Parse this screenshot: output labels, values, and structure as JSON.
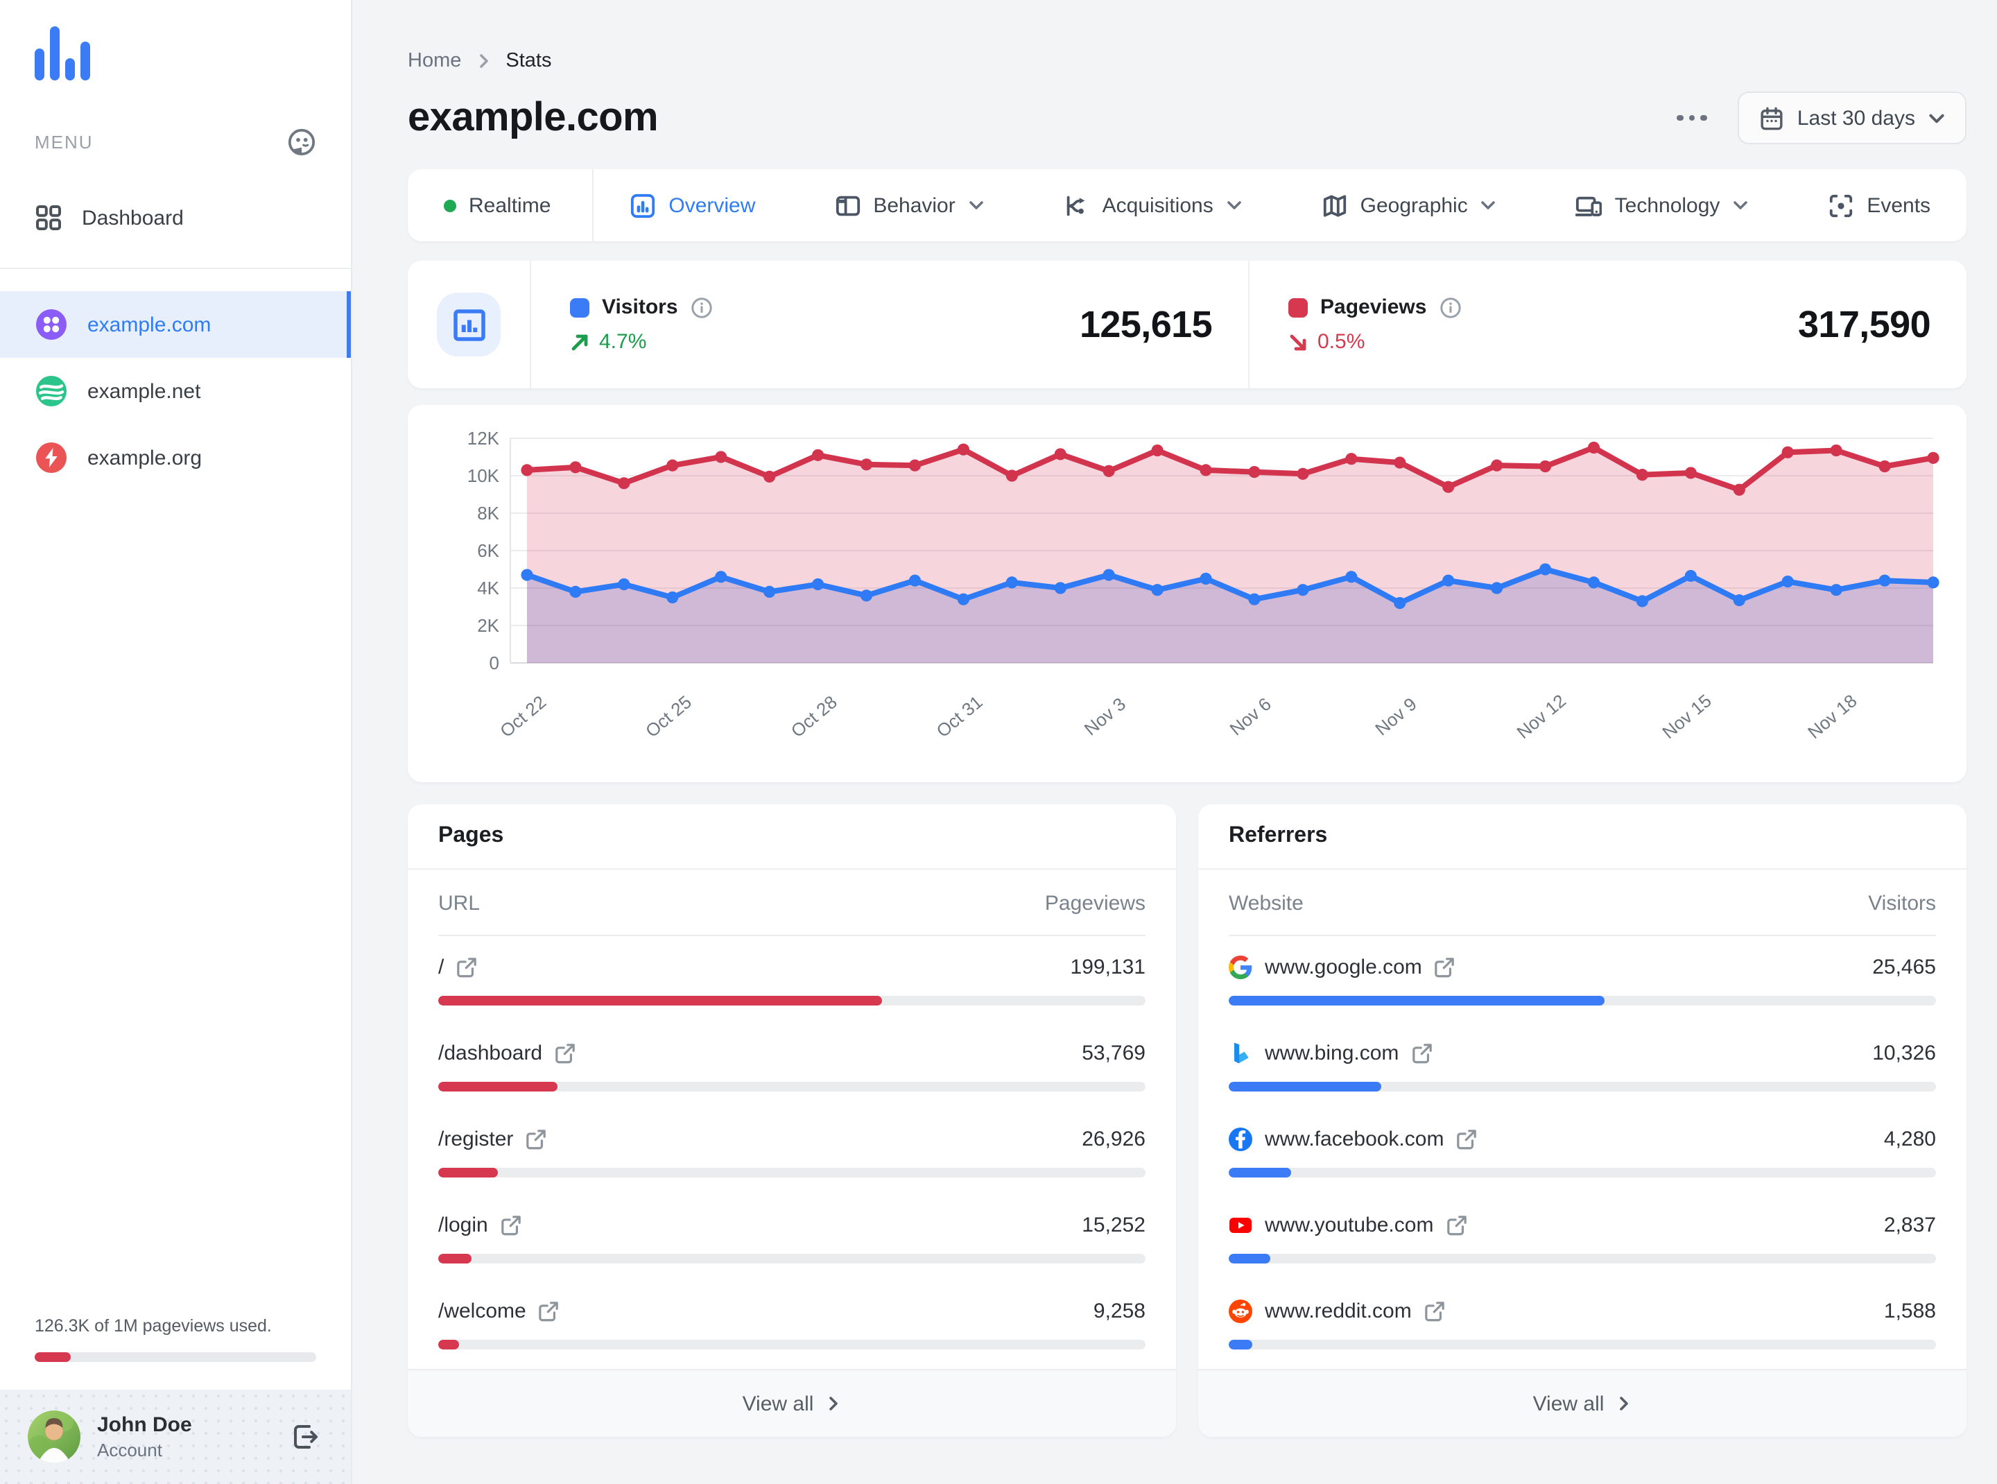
{
  "colors": {
    "accent_blue": "#3b7cf6",
    "accent_red": "#d6394f",
    "positive_green": "#1a9e4b",
    "negative_red": "#d63a4f",
    "realtime_green": "#1ea952",
    "site_purple": "#8b5cf6",
    "site_green": "#2bc48a",
    "site_red": "#ea5455"
  },
  "sidebar": {
    "menu_label": "MENU",
    "dashboard_label": "Dashboard",
    "sites": [
      {
        "label": "example.com"
      },
      {
        "label": "example.net"
      },
      {
        "label": "example.org"
      }
    ],
    "usage_text": "126.3K of 1M pageviews used.",
    "usage_used": 126300,
    "usage_total": 1000000,
    "user": {
      "name": "John Doe",
      "role": "Account"
    }
  },
  "header": {
    "breadcrumb_home": "Home",
    "breadcrumb_current": "Stats",
    "title": "example.com",
    "date_range": "Last 30 days"
  },
  "tabs": [
    {
      "label": "Realtime"
    },
    {
      "label": "Overview"
    },
    {
      "label": "Behavior"
    },
    {
      "label": "Acquisitions"
    },
    {
      "label": "Geographic"
    },
    {
      "label": "Technology"
    },
    {
      "label": "Events"
    }
  ],
  "stats": {
    "visitors": {
      "label": "Visitors",
      "value": "125,615",
      "change": "4.7%",
      "direction": "up"
    },
    "pageviews": {
      "label": "Pageviews",
      "value": "317,590",
      "change": "0.5%",
      "direction": "down"
    }
  },
  "chart_data": {
    "type": "area",
    "title": "",
    "xlabel": "",
    "ylabel": "",
    "ylim": [
      0,
      12000
    ],
    "y_tick_labels": [
      "0",
      "2K",
      "4K",
      "6K",
      "8K",
      "10K",
      "12K"
    ],
    "x_tick_labels": [
      "Oct 22",
      "Oct 25",
      "Oct 28",
      "Oct 31",
      "Nov 3",
      "Nov 6",
      "Nov 9",
      "Nov 12",
      "Nov 15",
      "Nov 18"
    ],
    "tick_every": 3,
    "grid": true,
    "legend_position": "none",
    "series": [
      {
        "name": "Pageviews",
        "color": "#d2344e",
        "fill": "rgba(210,52,78,0.20)",
        "values": [
          10300,
          10450,
          9600,
          10550,
          11000,
          9950,
          11100,
          10600,
          10550,
          11400,
          10000,
          11150,
          10250,
          11350,
          10300,
          10200,
          10100,
          10900,
          10700,
          9400,
          10550,
          10500,
          11500,
          10050,
          10150,
          9250,
          11250,
          11350,
          10500,
          10950
        ]
      },
      {
        "name": "Visitors",
        "color": "#2f7bf5",
        "fill": "rgba(73,80,196,0.22)",
        "values": [
          4700,
          3800,
          4200,
          3500,
          4600,
          3800,
          4200,
          3600,
          4400,
          3400,
          4300,
          4000,
          4700,
          3900,
          4500,
          3400,
          3900,
          4600,
          3200,
          4400,
          4000,
          5000,
          4300,
          3300,
          4650,
          3350,
          4350,
          3900,
          4400,
          4300
        ]
      }
    ]
  },
  "pages_panel": {
    "title": "Pages",
    "col_label": "URL",
    "col_value": "Pageviews",
    "bar_total": 317590,
    "view_all": "View all",
    "rows": [
      {
        "label": "/",
        "value": "199,131"
      },
      {
        "label": "/dashboard",
        "value": "53,769"
      },
      {
        "label": "/register",
        "value": "26,926"
      },
      {
        "label": "/login",
        "value": "15,252"
      },
      {
        "label": "/welcome",
        "value": "9,258"
      }
    ]
  },
  "referrers_panel": {
    "title": "Referrers",
    "col_label": "Website",
    "col_value": "Visitors",
    "bar_total": 48000,
    "view_all": "View all",
    "rows": [
      {
        "label": "www.google.com",
        "value": "25,465",
        "icon": "google"
      },
      {
        "label": "www.bing.com",
        "value": "10,326",
        "icon": "bing"
      },
      {
        "label": "www.facebook.com",
        "value": "4,280",
        "icon": "facebook"
      },
      {
        "label": "www.youtube.com",
        "value": "2,837",
        "icon": "youtube"
      },
      {
        "label": "www.reddit.com",
        "value": "1,588",
        "icon": "reddit"
      }
    ]
  }
}
